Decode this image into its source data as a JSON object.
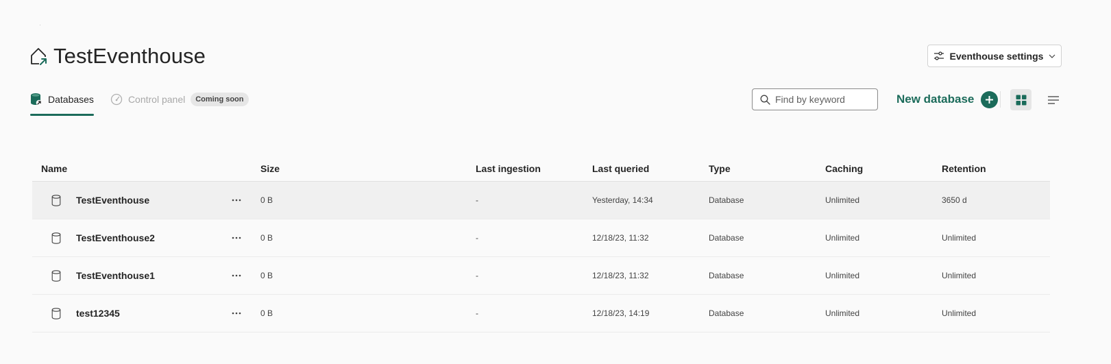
{
  "page": {
    "title": "TestEventhouse",
    "title_icon": "eventhouse-icon"
  },
  "header": {
    "settings_label": "Eventhouse settings",
    "settings_icon": "sliders-icon"
  },
  "tabs": [
    {
      "label": "Databases",
      "icon": "database-icon",
      "active": true
    },
    {
      "label": "Control panel",
      "icon": "gauge-icon",
      "active": false,
      "badge": "Coming soon"
    }
  ],
  "toolbar": {
    "search_placeholder": "Find by keyword",
    "new_database_label": "New database",
    "view_grid_icon": "grid-view-icon",
    "view_list_icon": "list-view-icon"
  },
  "colors": {
    "accent": "#1b6b5a",
    "background": "#fafafa"
  },
  "table": {
    "columns": [
      "Name",
      "Size",
      "Last ingestion",
      "Last queried",
      "Type",
      "Caching",
      "Retention"
    ],
    "rows": [
      {
        "name": "TestEventhouse",
        "size": "0 B",
        "last_ingestion": "-",
        "last_queried": "Yesterday, 14:34",
        "type": "Database",
        "caching": "Unlimited",
        "retention": "3650 d"
      },
      {
        "name": "TestEventhouse2",
        "size": "0 B",
        "last_ingestion": "-",
        "last_queried": "12/18/23, 11:32",
        "type": "Database",
        "caching": "Unlimited",
        "retention": "Unlimited"
      },
      {
        "name": "TestEventhouse1",
        "size": "0 B",
        "last_ingestion": "-",
        "last_queried": "12/18/23, 11:32",
        "type": "Database",
        "caching": "Unlimited",
        "retention": "Unlimited"
      },
      {
        "name": "test12345",
        "size": "0 B",
        "last_ingestion": "-",
        "last_queried": "12/18/23, 14:19",
        "type": "Database",
        "caching": "Unlimited",
        "retention": "Unlimited"
      }
    ]
  }
}
